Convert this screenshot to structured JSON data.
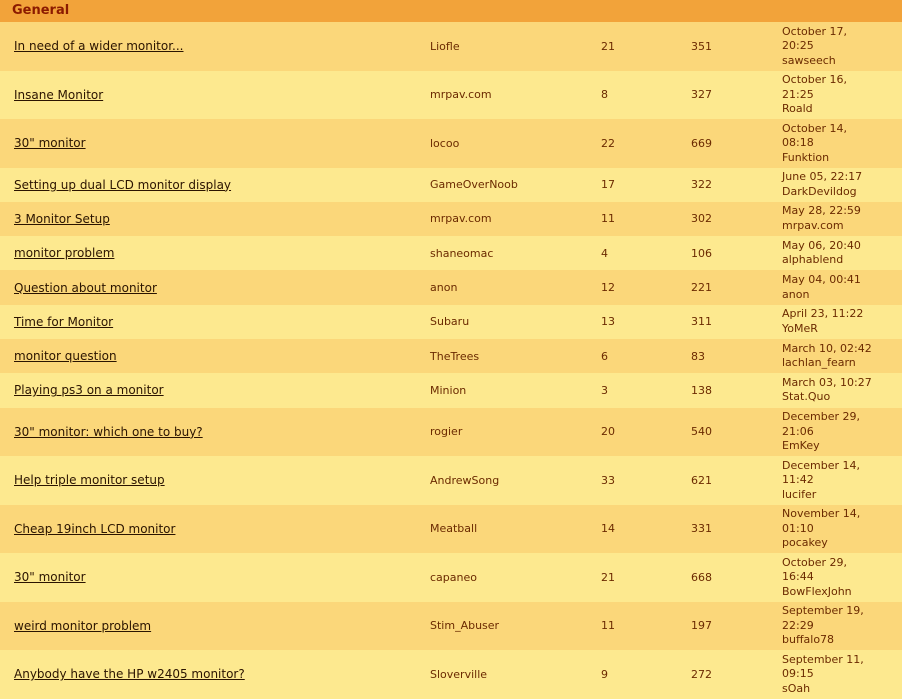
{
  "section": {
    "title": "General"
  },
  "threads": [
    {
      "title": "In need of a wider monitor...",
      "author": "Liofle",
      "replies": "21",
      "views": "351",
      "last_date": "October 17,",
      "last_time": "20:25",
      "last_user": "sawseech"
    },
    {
      "title": "Insane Monitor",
      "author": "mrpav.com",
      "replies": "8",
      "views": "327",
      "last_date": "October 16,",
      "last_time": "21:25",
      "last_user": "Roald"
    },
    {
      "title": "30\" monitor",
      "author": "locoo",
      "replies": "22",
      "views": "669",
      "last_date": "October 14,",
      "last_time": "08:18",
      "last_user": "Funktion"
    },
    {
      "title": "Setting up dual LCD monitor display",
      "author": "GameOverNoob",
      "replies": "17",
      "views": "322",
      "last_date": "June 05, 22:17",
      "last_time": "",
      "last_user": "DarkDevildog"
    },
    {
      "title": "3 Monitor Setup",
      "author": "mrpav.com",
      "replies": "11",
      "views": "302",
      "last_date": "May 28, 22:59",
      "last_time": "",
      "last_user": "mrpav.com"
    },
    {
      "title": "monitor problem",
      "author": "shaneomac",
      "replies": "4",
      "views": "106",
      "last_date": "May 06, 20:40",
      "last_time": "",
      "last_user": "alphablend"
    },
    {
      "title": "Question about monitor",
      "author": "anon",
      "replies": "12",
      "views": "221",
      "last_date": "May 04, 00:41",
      "last_time": "",
      "last_user": "anon"
    },
    {
      "title": "Time for Monitor",
      "author": "Subaru",
      "replies": "13",
      "views": "311",
      "last_date": "April 23, 11:22",
      "last_time": "",
      "last_user": "YoMeR"
    },
    {
      "title": "monitor question",
      "author": "TheTrees",
      "replies": "6",
      "views": "83",
      "last_date": "March 10, 02:42",
      "last_time": "",
      "last_user": "lachlan_fearn"
    },
    {
      "title": "Playing ps3 on a monitor",
      "author": "Minion",
      "replies": "3",
      "views": "138",
      "last_date": "March 03, 10:27",
      "last_time": "",
      "last_user": "Stat.Quo"
    },
    {
      "title": "30\" monitor: which one to buy?",
      "author": "rogier",
      "replies": "20",
      "views": "540",
      "last_date": "December 29,",
      "last_time": "21:06",
      "last_user": "EmKey"
    },
    {
      "title": "Help triple monitor setup",
      "author": "AndrewSong",
      "replies": "33",
      "views": "621",
      "last_date": "December 14,",
      "last_time": "11:42",
      "last_user": "lucifer"
    },
    {
      "title": "Cheap 19inch LCD monitor",
      "author": "Meatball",
      "replies": "14",
      "views": "331",
      "last_date": "November 14,",
      "last_time": "01:10",
      "last_user": "pocakey"
    },
    {
      "title": "30\" monitor",
      "author": "capaneo",
      "replies": "21",
      "views": "668",
      "last_date": "October 29,",
      "last_time": "16:44",
      "last_user": "BowFlexJohn"
    },
    {
      "title": "weird monitor problem",
      "author": "Stim_Abuser",
      "replies": "11",
      "views": "197",
      "last_date": "September 19,",
      "last_time": "22:29",
      "last_user": "buffalo78"
    },
    {
      "title": "Anybody have the HP w2405 monitor?",
      "author": "Sloverville",
      "replies": "9",
      "views": "272",
      "last_date": "September 11,",
      "last_time": "09:15",
      "last_user": "sOah"
    }
  ]
}
